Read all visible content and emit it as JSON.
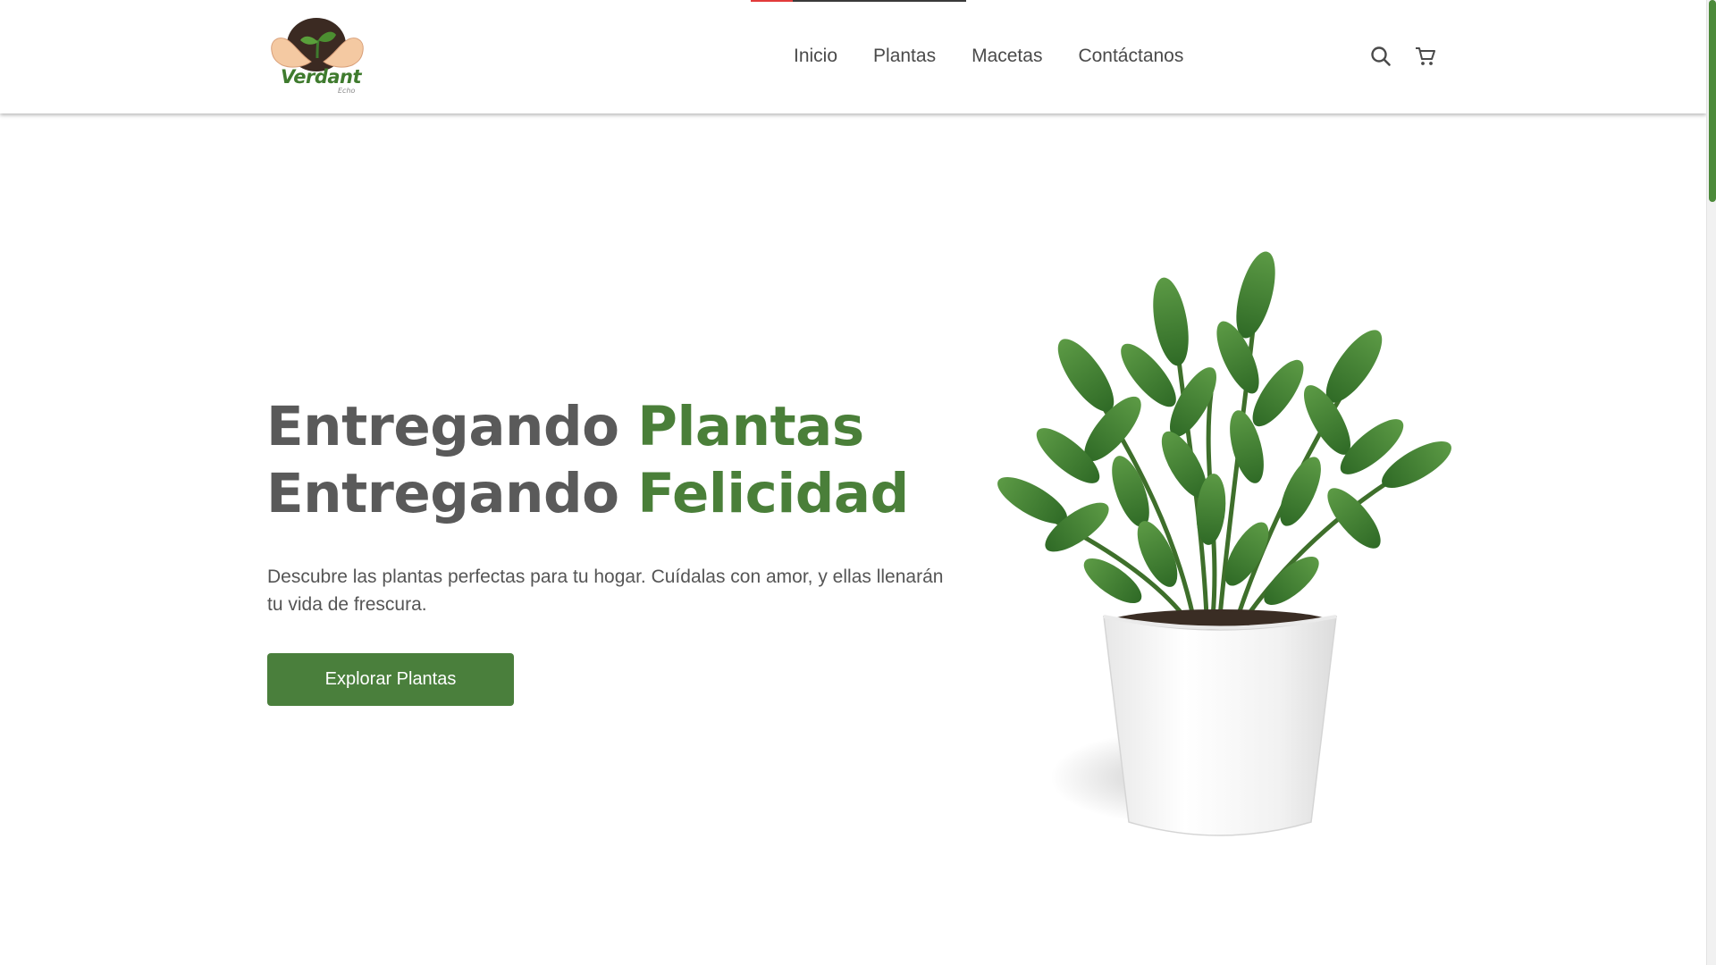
{
  "brand": {
    "name": "Verdant",
    "tagline": "Echo",
    "colors": {
      "primary_green": "#4a7f39",
      "text_gray": "#5a5a5a"
    }
  },
  "nav": {
    "items": [
      {
        "label": "Inicio"
      },
      {
        "label": "Plantas"
      },
      {
        "label": "Macetas"
      },
      {
        "label": "Contáctanos"
      }
    ]
  },
  "header_icons": {
    "search": "search-icon",
    "cart": "cart-icon"
  },
  "hero": {
    "line1_gray": "Entregando",
    "line1_green": "Plantas",
    "line2_gray": "Entregando",
    "line2_green": "Felicidad",
    "description": "Descubre las plantas perfectas para tu hogar. Cuídalas con amor, y ellas llenarán tu vida de frescura.",
    "cta_label": "Explorar Plantas"
  },
  "images": {
    "hero_plant": "potted-zz-plant-image"
  }
}
